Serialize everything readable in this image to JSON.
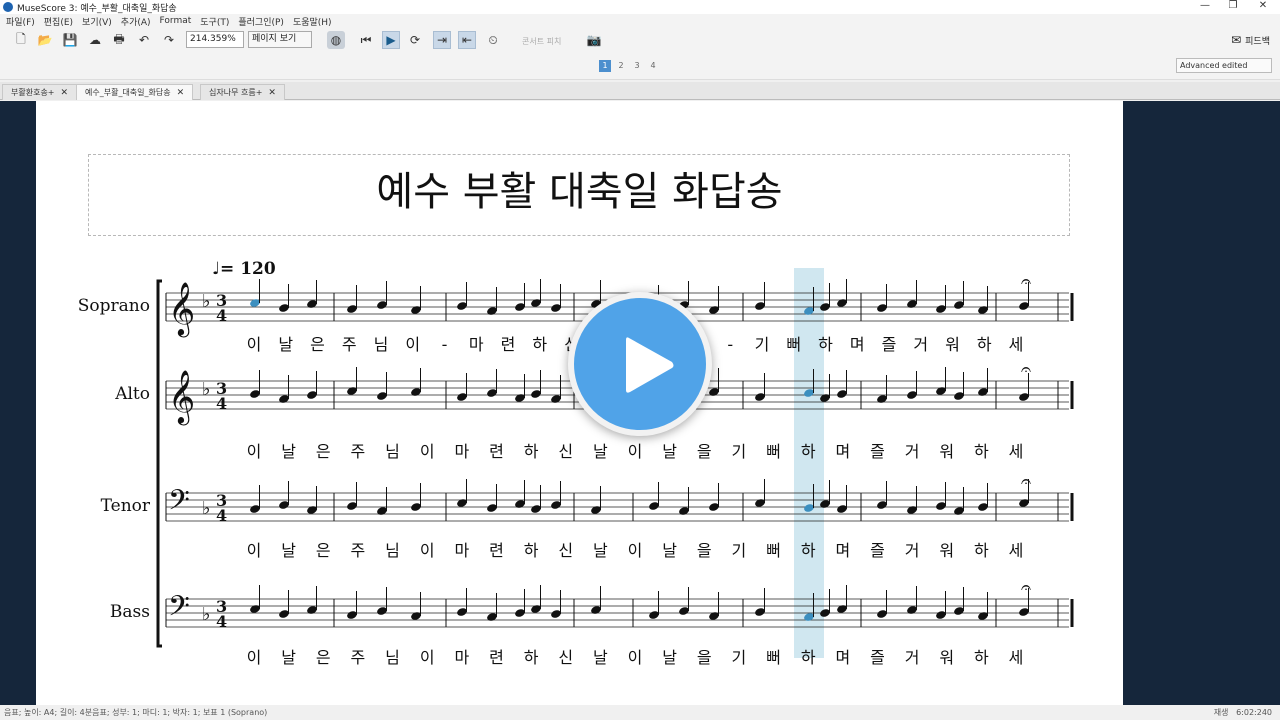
{
  "window": {
    "title": "MuseScore 3: 예수_부활_대축일_화답송",
    "controls": [
      "—",
      "❐",
      "✕"
    ]
  },
  "menu": [
    "파일(F)",
    "편집(E)",
    "보기(V)",
    "추가(A)",
    "Format",
    "도구(T)",
    "플러그인(P)",
    "도움말(H)"
  ],
  "toolbar": {
    "zoom_value": "214.359%",
    "view_mode": "페이지 보기",
    "concert_pitch_label": "콘서트 피치",
    "feedback_label": "피드백"
  },
  "note_input": {
    "voices": [
      "1",
      "2",
      "3",
      "4"
    ],
    "active_voice": "1",
    "workspace": "Advanced edited"
  },
  "tabs": [
    {
      "label": "부활환호송+",
      "active": false
    },
    {
      "label": "예수_부활_대축일_화답송",
      "active": true
    },
    {
      "label": "십자나무 흐름+",
      "active": false
    }
  ],
  "score": {
    "title": "예수 부활 대축일 화답송",
    "tempo_value": "= 120",
    "staves": [
      {
        "name": "Soprano",
        "lyrics": [
          "이",
          "날",
          "은",
          "주",
          "님",
          "이",
          "-",
          "마",
          "련",
          "하",
          "신",
          "날",
          "이",
          "날",
          "을",
          "-",
          "기",
          "뻐",
          "하",
          "며",
          "즐",
          "거",
          "워",
          "하",
          "세"
        ]
      },
      {
        "name": "Alto",
        "lyrics": [
          "이",
          "날",
          "은",
          "주",
          "님",
          "이",
          "마",
          "련",
          "하",
          "신",
          "날",
          "이",
          "날",
          "을",
          "기",
          "뻐",
          "하",
          "며",
          "즐",
          "거",
          "워",
          "하",
          "세"
        ]
      },
      {
        "name": "Tenor",
        "lyrics": [
          "이",
          "날",
          "은",
          "주",
          "님",
          "이",
          "마",
          "련",
          "하",
          "신",
          "날",
          "이",
          "날",
          "을",
          "기",
          "뻐",
          "하",
          "며",
          "즐",
          "거",
          "워",
          "하",
          "세"
        ]
      },
      {
        "name": "Bass",
        "lyrics": [
          "이",
          "날",
          "은",
          "주",
          "님",
          "이",
          "마",
          "련",
          "하",
          "신",
          "날",
          "이",
          "날",
          "을",
          "기",
          "뻐",
          "하",
          "며",
          "즐",
          "거",
          "워",
          "하",
          "세"
        ]
      }
    ]
  },
  "status": {
    "left": "음표; 높이: A4; 길이: 4분음표; 성부: 1; 마디: 1; 박자: 1; 보표 1 (Soprano)",
    "mode": "재생",
    "time": "6:02:240"
  },
  "colors": {
    "canvas_bg": "#15263b",
    "playback_cursor": "#a9d3e3",
    "play_button": "#50a3e8",
    "selected_note": "#3c8fbf"
  }
}
